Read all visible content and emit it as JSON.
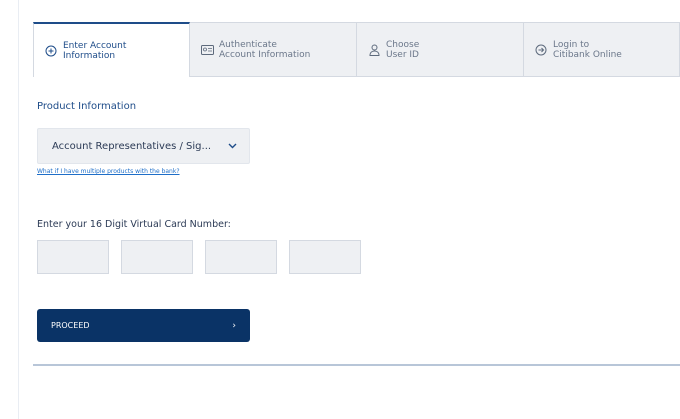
{
  "steps": [
    {
      "label": "Enter Account\nInformation",
      "icon": "plus-circle-icon",
      "active": true
    },
    {
      "label": "Authenticate\nAccount Information",
      "icon": "id-card-icon",
      "active": false
    },
    {
      "label": "Choose\nUser ID",
      "icon": "user-icon",
      "active": false
    },
    {
      "label": "Login to\nCitibank Online",
      "icon": "login-icon",
      "active": false
    }
  ],
  "form": {
    "section_title": "Product Information",
    "product_select_value": "Account Representatives / Sig...",
    "helper_link": "What if I have multiple products with the bank?",
    "card_label": "Enter your 16 Digit Virtual Card Number:",
    "proceed_label": "PROCEED",
    "proceed_arrow": "›"
  },
  "colors": {
    "accent": "#1e4c89",
    "button": "#0a3366",
    "field_bg": "#eef0f3"
  }
}
